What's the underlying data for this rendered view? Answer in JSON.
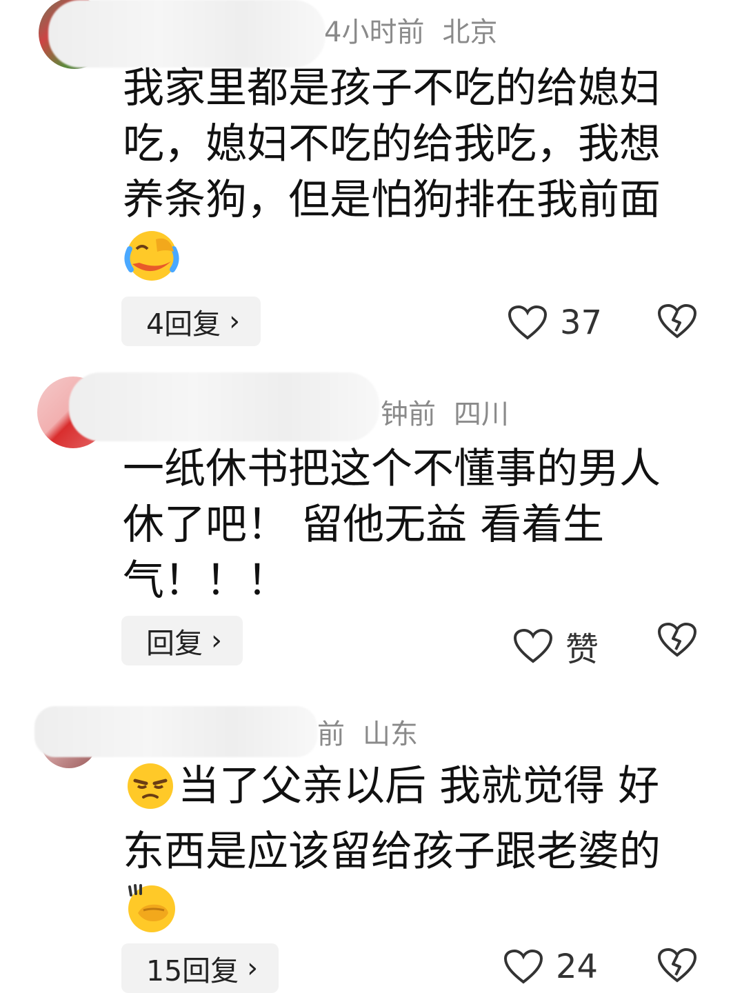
{
  "comments": [
    {
      "time": "4小时前",
      "location": "北京",
      "text": "我家里都是孩子不吃的给媳妇吃，媳妇不吃的给我吃，我想养条狗，但是怕狗排在我前面",
      "emoji": "laugh-cry-icon",
      "reply_label": "4回复",
      "like_count": "37"
    },
    {
      "time": "钟前",
      "location": "四川",
      "text_line1": "一纸休书把这个不懂事的男人",
      "text_line2": "休了吧！ 留他无益 看着生",
      "text_line3": "气！！！",
      "reply_label": "回复",
      "like_label": "赞"
    },
    {
      "time": "前",
      "location": "山东",
      "emoji_lead": "unamused-icon",
      "text_line1": "当了父亲以后 我就觉得  好",
      "text_line2": "东西是应该留给孩子跟老婆的",
      "emoji_tail": "face-palm-icon",
      "reply_label": "15回复",
      "like_count": "24"
    }
  ],
  "colors": {
    "meta_gray": "#8a8a8a",
    "button_bg": "#f2f2f2",
    "emoji_yellow": "#ffc928"
  }
}
